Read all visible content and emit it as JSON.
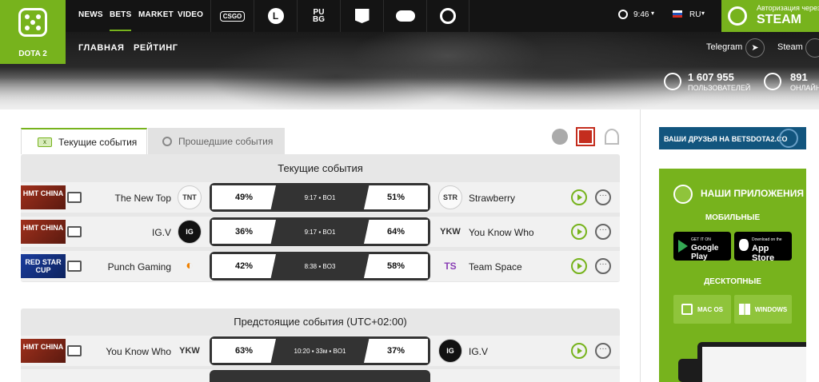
{
  "logo": {
    "label": "DOTA 2"
  },
  "nav": [
    "NEWS",
    "BETS",
    "MARKET",
    "VIDEO"
  ],
  "games": [
    "CSGO",
    "LoL",
    "PUBG",
    "Clash",
    "Gamepad",
    "Overwatch"
  ],
  "time": "9:46",
  "lang": "RU",
  "steam": {
    "top": "Авторизация через",
    "main": "STEAM"
  },
  "subnav": [
    "ГЛАВНАЯ",
    "РЕЙТИНГ"
  ],
  "social": [
    "Telegram",
    "Steam"
  ],
  "stats": {
    "users_count": "1 607 955",
    "users_label": "ПОЛЬЗОВАТЕЛЕЙ",
    "online_count": "891",
    "online_label": "ОНЛАЙН"
  },
  "tabs": {
    "current": "Текущие события",
    "past": "Прошедшие события"
  },
  "current_title": "Текущие события",
  "current": [
    {
      "tournament": "HMT CHINA",
      "left": "The New Top",
      "l_pct": "49%",
      "mid": "9:17 ▪ BO1",
      "r_pct": "51%",
      "right": "Strawberry"
    },
    {
      "tournament": "HMT CHINA",
      "left": "IG.V",
      "l_pct": "36%",
      "mid": "9:17 ▪ BO1",
      "r_pct": "64%",
      "right": "You Know Who"
    },
    {
      "tournament": "RED STAR CUP",
      "left": "Punch Gaming",
      "l_pct": "42%",
      "mid": "8:38 ▪ BO3",
      "r_pct": "58%",
      "right": "Team Space"
    }
  ],
  "upcoming_title": "Предстоящие события (UTC+02:00)",
  "upcoming": [
    {
      "tournament": "HMT CHINA",
      "left": "You Know Who",
      "l_pct": "63%",
      "mid": "10:20 ▪ 33м ▪ BO1",
      "r_pct": "37%",
      "right": "IG.V"
    }
  ],
  "sidebar": {
    "friends": "ВАШИ ДРУЗЬЯ НА BETSDOTA2.CO",
    "apps_title": "НАШИ ПРИЛОЖЕНИЯ",
    "mobile": "МОБИЛЬНЫЕ",
    "google_small": "GET IT ON",
    "google": "Google Play",
    "apple_small": "Download on the",
    "apple": "App Store",
    "desktop": "ДЕСКТОПНЫЕ",
    "mac": "MAC OS",
    "win": "WINDOWS"
  },
  "colors": {
    "accent": "#77b31d",
    "dark": "#141414",
    "friends_bg": "#12557e"
  }
}
